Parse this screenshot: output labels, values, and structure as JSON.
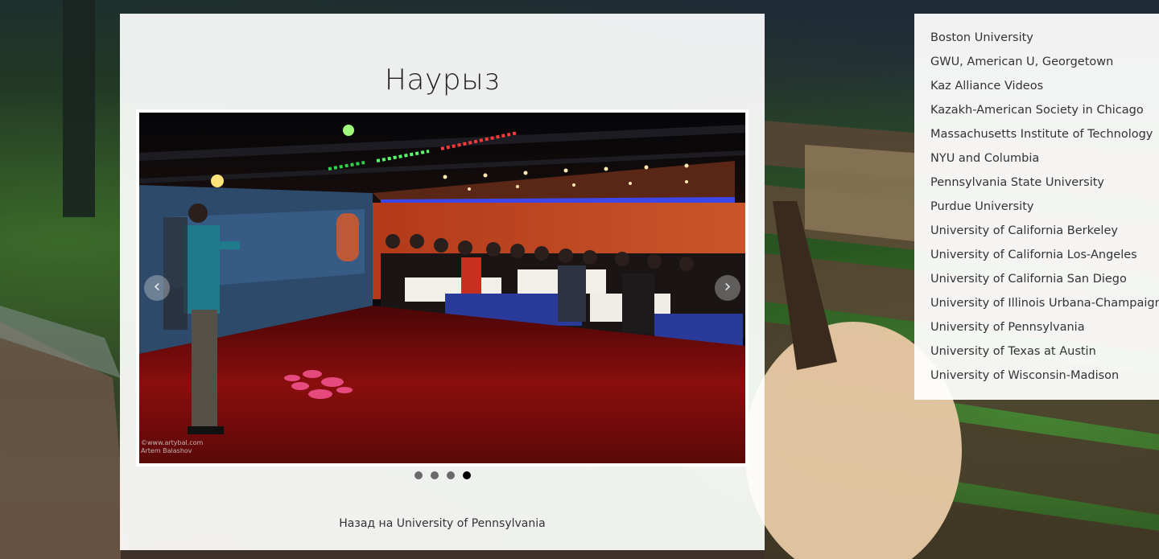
{
  "page": {
    "title": "Наурыз",
    "back_link": "Назад на University of Pennsylvania"
  },
  "slider": {
    "prev_icon": "chevron-left-icon",
    "next_icon": "chevron-right-icon",
    "prev_glyph": "‹",
    "next_glyph": "›",
    "credit_line1": "©www.artybal.com",
    "credit_line2": "Artem Balashov",
    "slide_count": 4,
    "active_slide": 4
  },
  "sidebar": {
    "items": [
      {
        "label": "Boston University"
      },
      {
        "label": "GWU, American U, Georgetown"
      },
      {
        "label": "Kaz Alliance Videos"
      },
      {
        "label": "Kazakh-American Society in Chicago"
      },
      {
        "label": "Massachusetts Institute of Technology"
      },
      {
        "label": "NYU and Columbia"
      },
      {
        "label": "Pennsylvania State University"
      },
      {
        "label": "Purdue University"
      },
      {
        "label": "University of California Berkeley"
      },
      {
        "label": "University of California Los-Angeles"
      },
      {
        "label": "University of California San Diego"
      },
      {
        "label": "University of Illinois Urbana-Champaign"
      },
      {
        "label": "University of Pennsylvania"
      },
      {
        "label": "University of Texas at Austin"
      },
      {
        "label": "University of Wisconsin-Madison"
      }
    ]
  },
  "colors": {
    "panel_bg": "#ffffff",
    "text": "#333333",
    "dot_inactive": "#6a6a6a",
    "dot_active": "#000000",
    "floor_red": "#8a0e0e"
  }
}
